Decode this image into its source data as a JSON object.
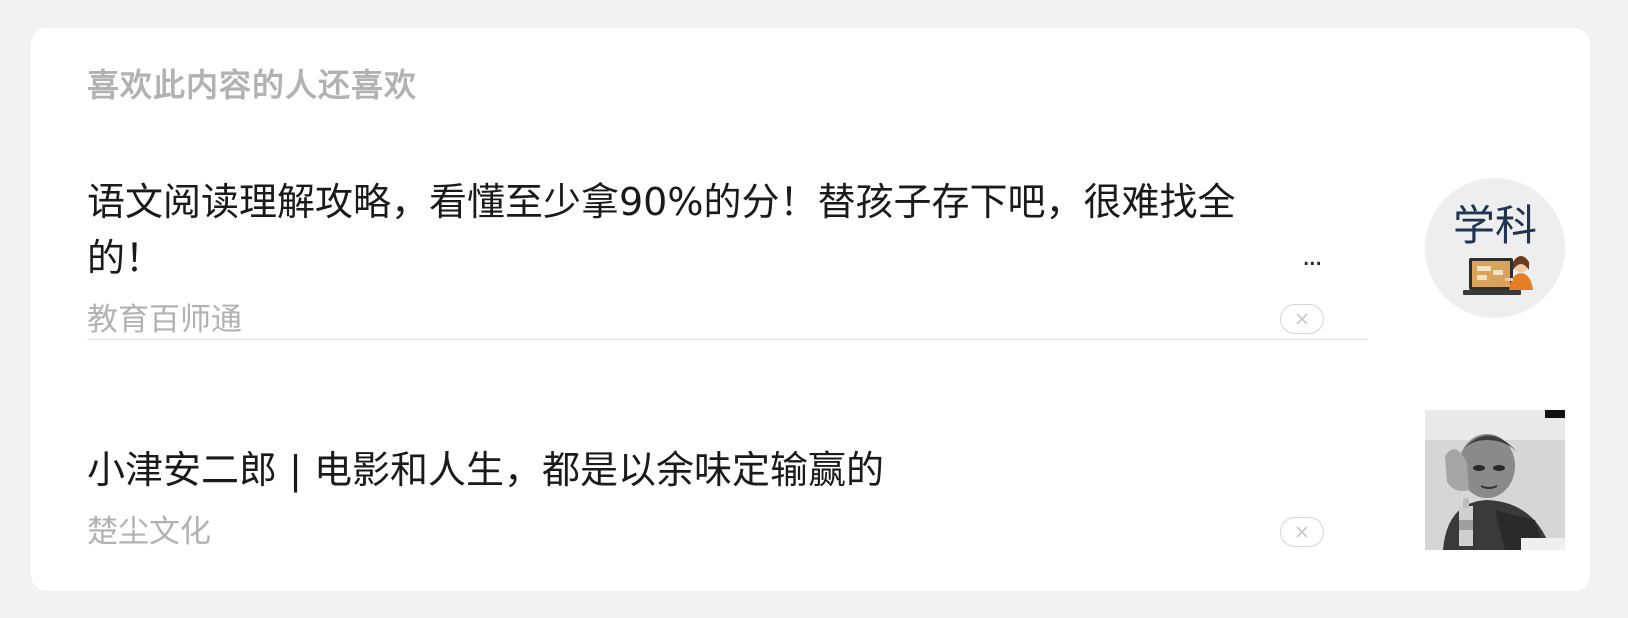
{
  "section": {
    "title": "喜欢此内容的人还喜欢"
  },
  "articles": [
    {
      "title": "语文阅读理解攻略，看懂至少拿90%的分！替孩子存下吧，很难找全的！",
      "ellipsis": "...",
      "source": "教育百师通",
      "thumbnail_text": "学科",
      "thumbnail_icon": "teacher-laptop-illustration"
    },
    {
      "title": "小津安二郎 | 电影和人生，都是以余味定输赢的",
      "source": "楚尘文化",
      "thumbnail_icon": "portrait-photo"
    }
  ],
  "colors": {
    "background": "#f2f2f2",
    "card": "#ffffff",
    "title_text": "#1a1a1a",
    "muted_text": "#b2b2b2",
    "thumb_text": "#1f3550"
  }
}
